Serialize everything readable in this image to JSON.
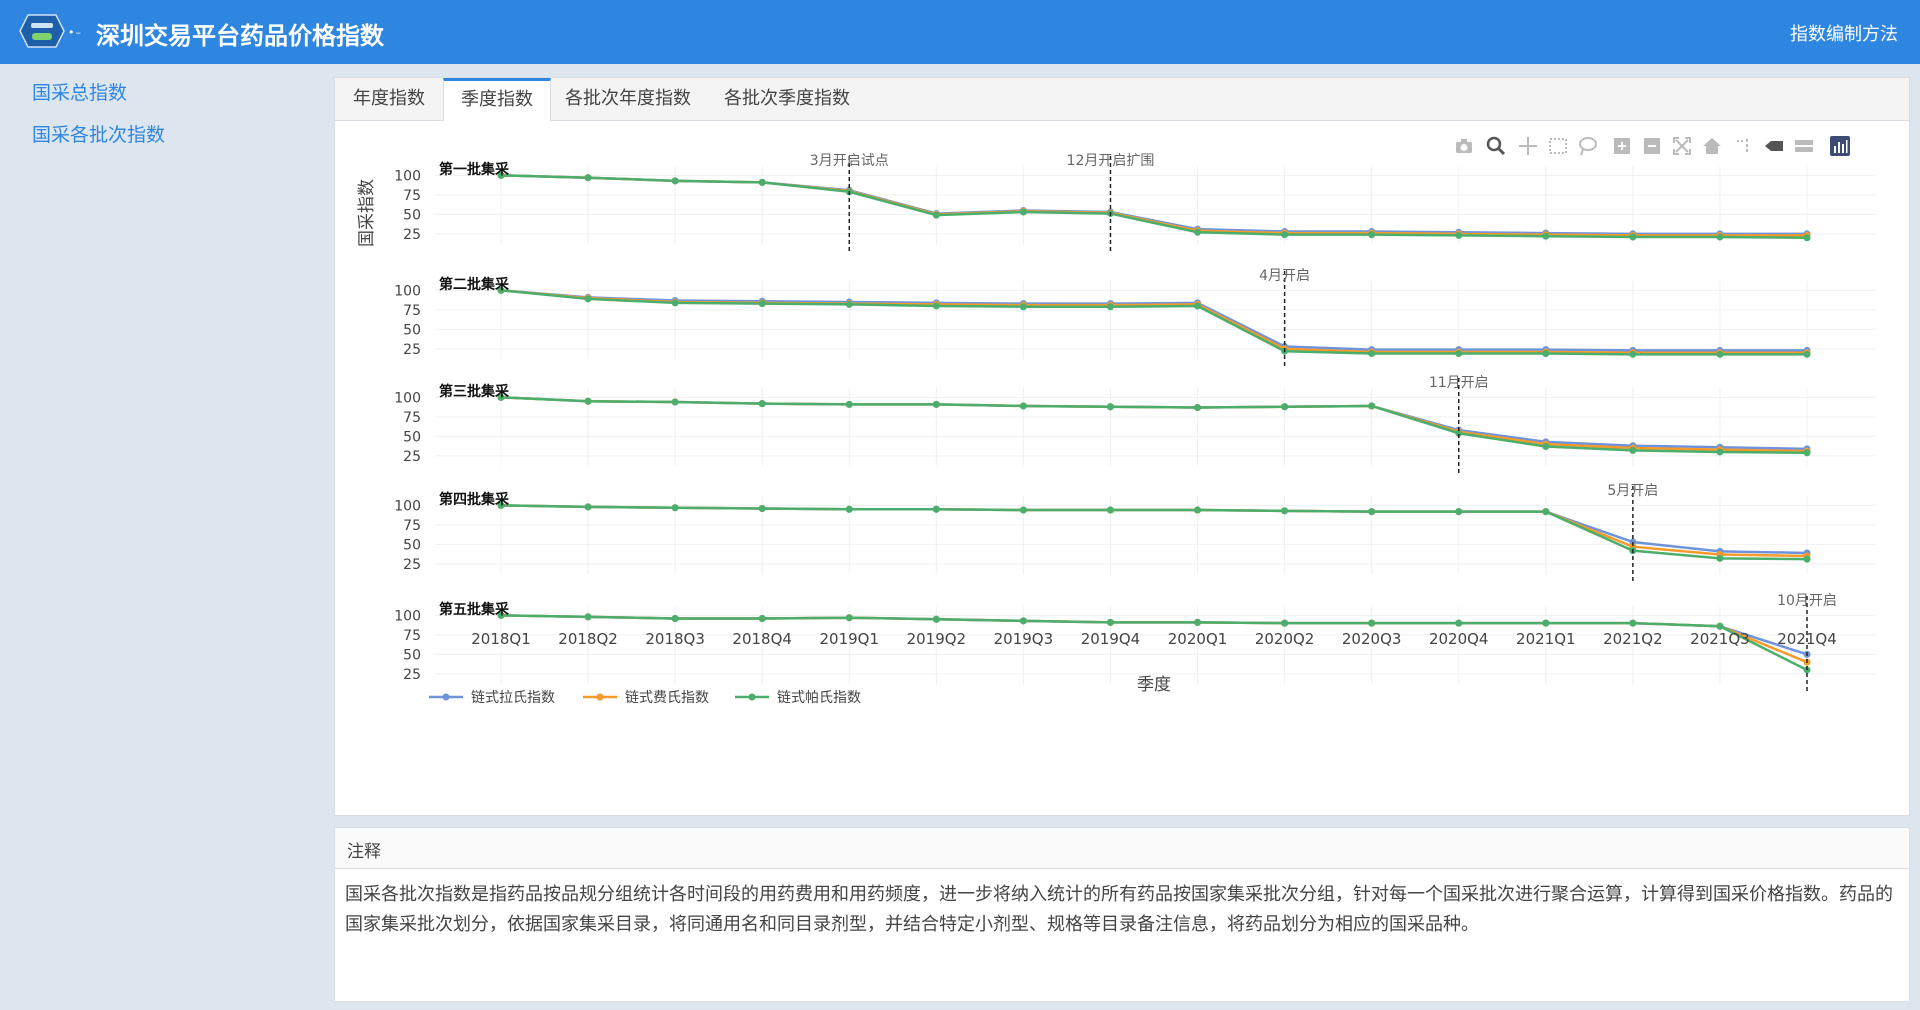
{
  "header": {
    "title": "深圳交易平台药品价格指数",
    "method_link": "指数编制方法"
  },
  "sidebar": {
    "items": [
      {
        "label": "国采总指数"
      },
      {
        "label": "国采各批次指数"
      }
    ]
  },
  "tabs": [
    {
      "label": "年度指数",
      "active": false
    },
    {
      "label": "季度指数",
      "active": true
    },
    {
      "label": "各批次年度指数",
      "active": false
    },
    {
      "label": "各批次季度指数",
      "active": false
    }
  ],
  "toolbar": {
    "icons": [
      "camera-icon",
      "zoom-icon",
      "pan-icon",
      "box-select-icon",
      "lasso-select-icon",
      "zoom-in-icon",
      "zoom-out-icon",
      "autoscale-icon",
      "reset-axes-icon",
      "spike-lines-icon",
      "hover-closest-icon",
      "hover-compare-icon",
      "plotly-logo-icon"
    ]
  },
  "colors": {
    "header": "#2f86e0",
    "laspeyres": "#6e93dc",
    "fisher": "#f59a2b",
    "paasche": "#4cae6c"
  },
  "chart_data": {
    "type": "line",
    "xlabel": "季度",
    "ylabel": "国采指数",
    "categories": [
      "2018Q1",
      "2018Q2",
      "2018Q3",
      "2018Q4",
      "2019Q1",
      "2019Q2",
      "2019Q3",
      "2019Q4",
      "2020Q1",
      "2020Q2",
      "2020Q3",
      "2020Q4",
      "2021Q1",
      "2021Q2",
      "2021Q3",
      "2021Q4"
    ],
    "yticks": [
      100,
      75,
      50,
      25
    ],
    "legend": [
      {
        "name": "链式拉氏指数",
        "color": "#6e93dc"
      },
      {
        "name": "链式费氏指数",
        "color": "#f59a2b"
      },
      {
        "name": "链式帕氏指数",
        "color": "#4cae6c"
      }
    ],
    "legend_position": "bottom-left",
    "subplots": [
      {
        "label": "第一批集采",
        "events": [
          {
            "text": "3月开启试点",
            "x": 4
          },
          {
            "text": "12月开启扩围",
            "x": 7
          }
        ],
        "series": [
          [
            100,
            97,
            93,
            91,
            81,
            51,
            55,
            53,
            31,
            28,
            28,
            27,
            26,
            25,
            25,
            25
          ],
          [
            100,
            97,
            93,
            91,
            80,
            50,
            54,
            52,
            29,
            26,
            26,
            25,
            24,
            23,
            23,
            23
          ],
          [
            100,
            97,
            93,
            91,
            79,
            49,
            53,
            51,
            27,
            24,
            24,
            23,
            22,
            21,
            21,
            20
          ]
        ]
      },
      {
        "label": "第二批集采",
        "events": [
          {
            "text": "4月开启",
            "x": 9
          }
        ],
        "series": [
          [
            100,
            91,
            87,
            86,
            85,
            84,
            83,
            83,
            84,
            28,
            24,
            24,
            24,
            23,
            23,
            23
          ],
          [
            100,
            90,
            85,
            84,
            83,
            82,
            81,
            81,
            82,
            25,
            21,
            21,
            21,
            20,
            20,
            20
          ],
          [
            100,
            89,
            84,
            83,
            82,
            80,
            79,
            79,
            80,
            22,
            19,
            19,
            19,
            18,
            18,
            18
          ]
        ]
      },
      {
        "label": "第三批集采",
        "events": [
          {
            "text": "11月开启",
            "x": 11
          }
        ],
        "series": [
          [
            100,
            95,
            94,
            92,
            91,
            91,
            89,
            88,
            87,
            88,
            89,
            58,
            43,
            38,
            36,
            34
          ],
          [
            100,
            95,
            94,
            92,
            91,
            91,
            89,
            88,
            87,
            88,
            89,
            56,
            40,
            35,
            33,
            31
          ],
          [
            100,
            95,
            94,
            92,
            91,
            91,
            89,
            88,
            87,
            88,
            89,
            54,
            37,
            32,
            30,
            29
          ]
        ]
      },
      {
        "label": "第四批集采",
        "events": [
          {
            "text": "5月开启",
            "x": 13
          }
        ],
        "series": [
          [
            100,
            98,
            97,
            96,
            95,
            95,
            94,
            94,
            94,
            93,
            92,
            92,
            92,
            53,
            41,
            39
          ],
          [
            100,
            98,
            97,
            96,
            95,
            95,
            94,
            94,
            94,
            93,
            92,
            92,
            92,
            47,
            37,
            35
          ],
          [
            100,
            98,
            97,
            96,
            95,
            95,
            94,
            94,
            94,
            93,
            92,
            92,
            92,
            42,
            32,
            31
          ]
        ]
      },
      {
        "label": "第五批集采",
        "events": [
          {
            "text": "10月开启",
            "x": 15
          }
        ],
        "series": [
          [
            100,
            98,
            96,
            96,
            97,
            95,
            93,
            91,
            91,
            90,
            90,
            90,
            90,
            90,
            86,
            50
          ],
          [
            100,
            98,
            96,
            96,
            97,
            95,
            93,
            91,
            91,
            90,
            90,
            90,
            90,
            90,
            86,
            40
          ],
          [
            100,
            98,
            96,
            96,
            97,
            95,
            93,
            91,
            91,
            90,
            90,
            90,
            90,
            90,
            86,
            30
          ]
        ]
      }
    ]
  },
  "note": {
    "title": "注释",
    "body": "国采各批次指数是指药品按品规分组统计各时间段的用药费用和用药频度，进一步将纳入统计的所有药品按国家集采批次分组，针对每一个国采批次进行聚合运算，计算得到国采价格指数。药品的国家集采批次划分，依据国家集采目录，将同通用名和同目录剂型，并结合特定小剂型、规格等目录备注信息，将药品划分为相应的国采品种。"
  }
}
